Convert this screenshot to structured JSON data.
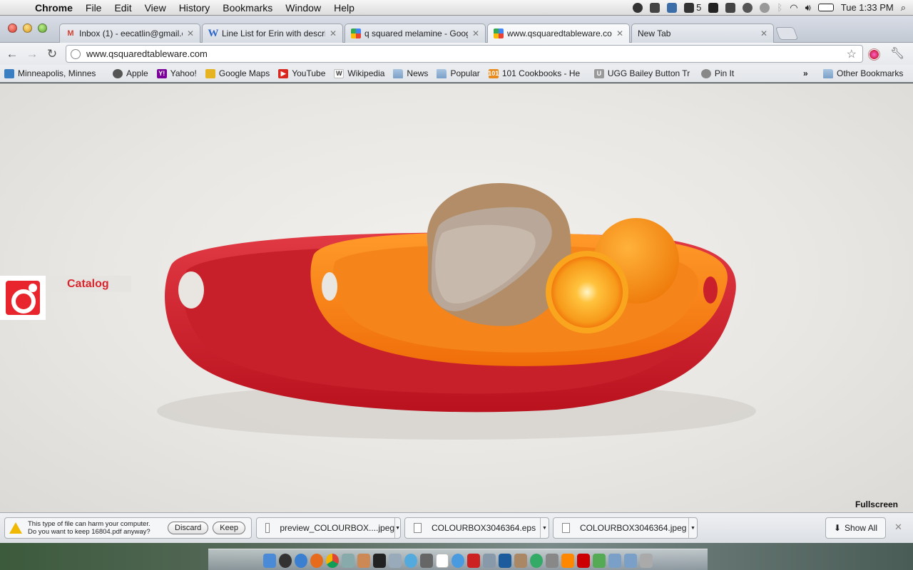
{
  "menubar": {
    "app_name": "Chrome",
    "menus": [
      "File",
      "Edit",
      "View",
      "History",
      "Bookmarks",
      "Window",
      "Help"
    ],
    "adobe_count": "5",
    "clock": "Tue 1:33 PM"
  },
  "tabs": [
    {
      "title": "Inbox (1) - eecatlin@gmail.c",
      "favicon": "gmail-icon",
      "active": false
    },
    {
      "title": "Line List for Erin with descrip",
      "favicon": "W",
      "active": false
    },
    {
      "title": "q squared melamine - Googl",
      "favicon": "google-icon",
      "active": false
    },
    {
      "title": "www.qsquaredtableware.com",
      "favicon": "google-icon",
      "active": true
    },
    {
      "title": "New Tab",
      "favicon": "",
      "active": false
    }
  ],
  "omnibox": {
    "url": "www.qsquaredtableware.com"
  },
  "bookmarks": [
    {
      "label": "Minneapolis, Minnes",
      "icon": "weather-icon",
      "color": "#3a7fc2"
    },
    {
      "label": "Apple",
      "icon": "apple-icon",
      "color": "#555555"
    },
    {
      "label": "Yahoo!",
      "icon": "yahoo-icon",
      "color": "#7b0099"
    },
    {
      "label": "Google Maps",
      "icon": "maps-icon",
      "color": "#e6b422"
    },
    {
      "label": "YouTube",
      "icon": "youtube-icon",
      "color": "#d9281f"
    },
    {
      "label": "Wikipedia",
      "icon": "wikipedia-icon",
      "color": "#777777"
    },
    {
      "label": "News",
      "icon": "folder-icon",
      "color": ""
    },
    {
      "label": "Popular",
      "icon": "folder-icon",
      "color": ""
    },
    {
      "label": "101 Cookbooks - He",
      "icon": "cookbook-icon",
      "color": "#e88b1c"
    },
    {
      "label": "UGG Bailey Button Tr",
      "icon": "ugg-icon",
      "color": "#999999"
    },
    {
      "label": "Pin It",
      "icon": "pin-icon",
      "color": "#888888"
    }
  ],
  "bookmarks_chevron": "»",
  "other_bookmarks": "Other Bookmarks",
  "page": {
    "catalog_label": "Catalog",
    "fullscreen_label": "Fullscreen",
    "brand_color": "#e8242c"
  },
  "download_shelf": {
    "warning_line1": "This type of file can harm your computer.",
    "warning_line2": "Do you want to keep 16804.pdf anyway?",
    "discard_label": "Discard",
    "keep_label": "Keep",
    "downloads": [
      "preview_COLOURBOX....jpeg",
      "COLOURBOX3046364.eps",
      "COLOURBOX3046364.jpeg"
    ],
    "show_all_label": "Show All"
  }
}
